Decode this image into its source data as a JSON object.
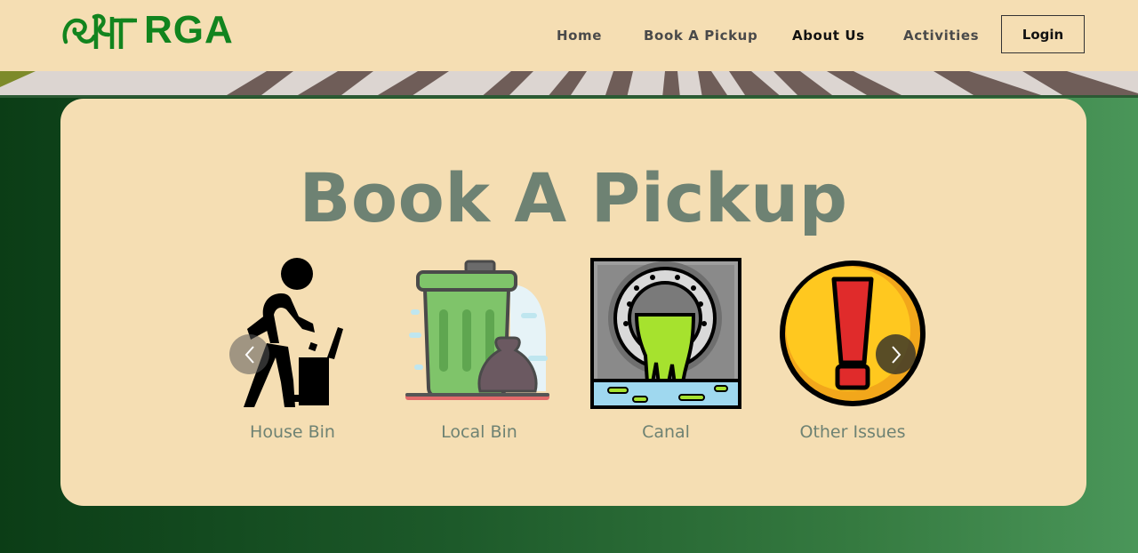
{
  "brand": {
    "logo_text": "RGA",
    "logo_accessible_name": "सारगा",
    "color": "#12841e"
  },
  "nav": {
    "items": [
      {
        "label": "Home"
      },
      {
        "label": "Book A Pickup"
      },
      {
        "label": "About Us"
      },
      {
        "label": "Activities"
      }
    ],
    "active_index": 2,
    "login_label": "Login"
  },
  "main": {
    "title": "Book A Pickup",
    "title_color": "#6e8273",
    "card_color": "#f5deb3",
    "options": [
      {
        "label": "House Bin",
        "icon": "person-throwing-trash-icon"
      },
      {
        "label": "Local Bin",
        "icon": "trash-can-with-bag-icon"
      },
      {
        "label": "Canal",
        "icon": "sewage-pipe-icon"
      },
      {
        "label": "Other Issues",
        "icon": "exclamation-warning-icon"
      }
    ],
    "prev_arrow": "chevron-left-icon",
    "next_arrow": "chevron-right-icon"
  }
}
